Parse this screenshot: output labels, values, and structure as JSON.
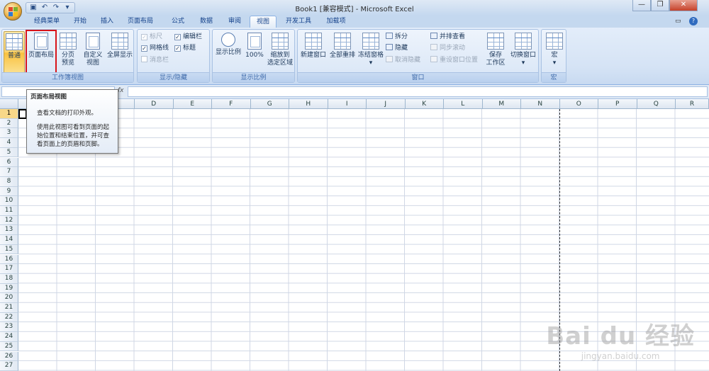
{
  "window": {
    "title": "Book1  [兼容模式] - Microsoft Excel",
    "minimize": "—",
    "restore": "❐",
    "close": "✕"
  },
  "quick_access": {
    "save_icon": "save-icon",
    "undo_icon": "undo-icon",
    "redo_icon": "redo-icon",
    "more_icon": "dropdown-icon"
  },
  "tabs": [
    {
      "label": "经典菜单"
    },
    {
      "label": "开始"
    },
    {
      "label": "插入"
    },
    {
      "label": "页面布局"
    },
    {
      "label": "公式"
    },
    {
      "label": "数据"
    },
    {
      "label": "审阅"
    },
    {
      "label": "视图",
      "active": true
    },
    {
      "label": "开发工具"
    },
    {
      "label": "加载项"
    }
  ],
  "ribbon": {
    "workbook_views": {
      "label": "工作簿视图",
      "normal": "普通",
      "page_layout": "页面布局",
      "page_break_line1": "分页",
      "page_break_line2": "预览",
      "custom_line1": "自定义",
      "custom_line2": "视图",
      "fullscreen": "全屏显示"
    },
    "show_hide": {
      "label": "显示/隐藏",
      "ruler": "标尺",
      "gridlines": "网格线",
      "message_bar": "消息栏",
      "formula_bar": "编辑栏",
      "headings": "标题"
    },
    "zoom": {
      "label": "显示比例",
      "zoom": "显示比例",
      "hundred": "100%",
      "zoom_selection_line1": "缩放到",
      "zoom_selection_line2": "选定区域"
    },
    "window": {
      "label": "窗口",
      "new_window": "新建窗口",
      "arrange_all": "全部重排",
      "freeze_panes": "冻结窗格",
      "split": "拆分",
      "hide": "隐藏",
      "unhide": "取消隐藏",
      "side_by_side": "并排查看",
      "sync_scroll": "同步滚动",
      "reset_position": "重设窗口位置",
      "save_workspace_line1": "保存",
      "save_workspace_line2": "工作区",
      "switch_windows": "切换窗口"
    },
    "macros": {
      "label": "宏",
      "macros": "宏"
    }
  },
  "formula_bar": {
    "fx": "fx"
  },
  "columns": [
    "D",
    "E",
    "F",
    "G",
    "H",
    "I",
    "J",
    "K",
    "L",
    "M",
    "N",
    "O",
    "P",
    "Q",
    "R"
  ],
  "rows": [
    "1",
    "2",
    "3",
    "4",
    "5",
    "6",
    "7",
    "8",
    "9",
    "10",
    "11",
    "12",
    "13",
    "14",
    "15",
    "16",
    "17",
    "18",
    "19",
    "20",
    "21",
    "22",
    "23",
    "24",
    "25",
    "26",
    "27"
  ],
  "tooltip": {
    "title": "页面布局视图",
    "line1": "查看文档的打印外观。",
    "desc": "使用此视图可看到页面的起始位置和结束位置，并可查看页面上的页眉和页脚。"
  },
  "watermark": {
    "brand": "Bai du 经验",
    "url": "jingyan.baidu.com"
  }
}
